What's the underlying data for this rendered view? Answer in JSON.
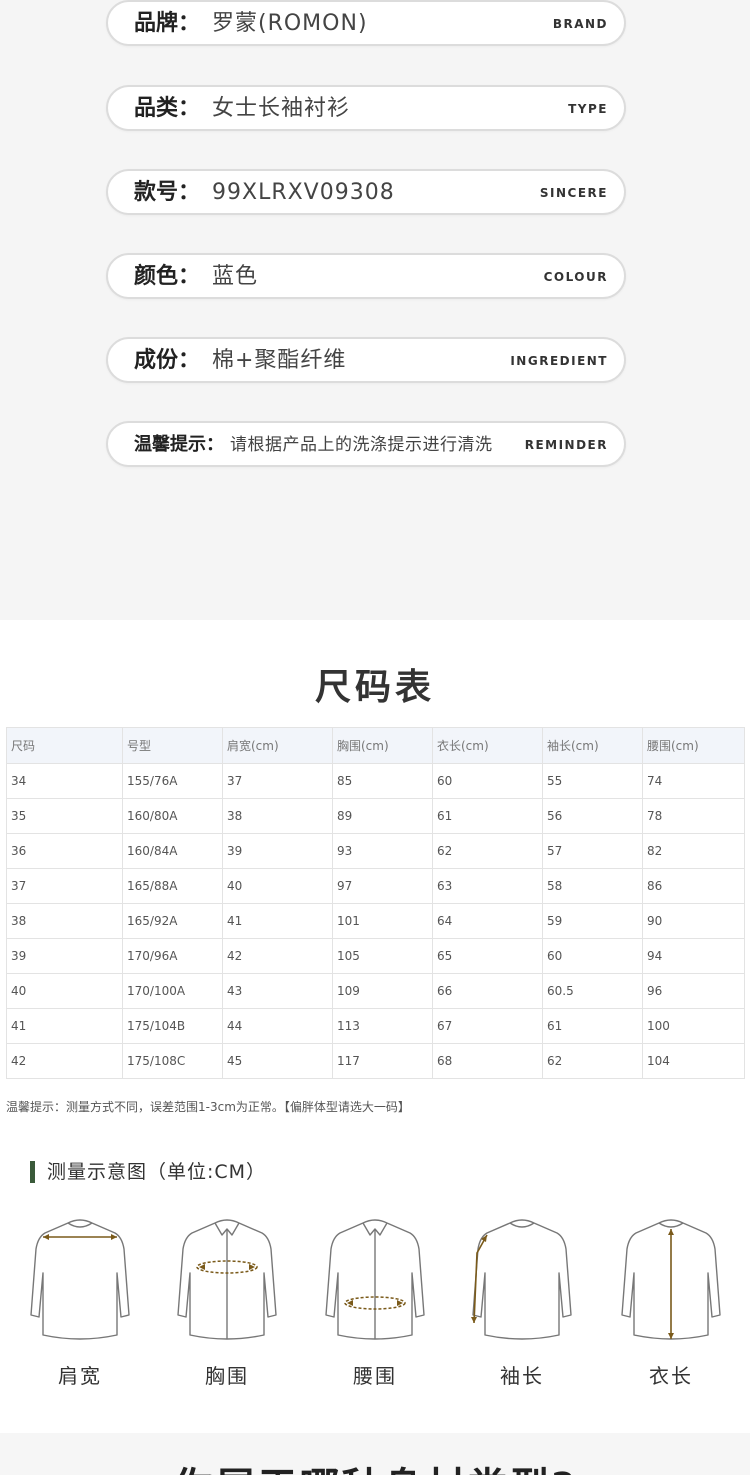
{
  "info": {
    "brand": {
      "label": "品牌：",
      "value": "罗蒙(ROMON)",
      "en": "BRAND"
    },
    "type": {
      "label": "品类：",
      "value": "女士长袖衬衫",
      "en": "TYPE"
    },
    "style": {
      "label": "款号：",
      "value": "99XLRXV09308",
      "en": "SINCERE"
    },
    "color": {
      "label": "颜色：",
      "value": "蓝色",
      "en": "COLOUR"
    },
    "ingredient": {
      "label": "成份：",
      "value": "棉+聚酯纤维",
      "en": "INGREDIENT"
    },
    "reminder": {
      "label": "温馨提示：",
      "value": "请根据产品上的洗涤提示进行清洗",
      "en": "REMINDER"
    }
  },
  "size_table": {
    "title": "尺码表",
    "headers": [
      "尺码",
      "号型",
      "肩宽(cm)",
      "胸围(cm)",
      "衣长(cm)",
      "袖长(cm)",
      "腰围(cm)"
    ],
    "rows": [
      [
        "34",
        "155/76A",
        "37",
        "85",
        "60",
        "55",
        "74"
      ],
      [
        "35",
        "160/80A",
        "38",
        "89",
        "61",
        "56",
        "78"
      ],
      [
        "36",
        "160/84A",
        "39",
        "93",
        "62",
        "57",
        "82"
      ],
      [
        "37",
        "165/88A",
        "40",
        "97",
        "63",
        "58",
        "86"
      ],
      [
        "38",
        "165/92A",
        "41",
        "101",
        "64",
        "59",
        "90"
      ],
      [
        "39",
        "170/96A",
        "42",
        "105",
        "65",
        "60",
        "94"
      ],
      [
        "40",
        "170/100A",
        "43",
        "109",
        "66",
        "60.5",
        "96"
      ],
      [
        "41",
        "175/104B",
        "44",
        "113",
        "67",
        "61",
        "100"
      ],
      [
        "42",
        "175/108C",
        "45",
        "117",
        "68",
        "62",
        "104"
      ]
    ],
    "note": "温馨提示：测量方式不同，误差范围1-3cm为正常。【偏胖体型请选大一码】"
  },
  "measure": {
    "heading": "测量示意图（单位:CM）",
    "items": [
      {
        "label": "肩宽",
        "icon": "shirt-shoulder-width-icon"
      },
      {
        "label": "胸围",
        "icon": "shirt-chest-icon"
      },
      {
        "label": "腰围",
        "icon": "shirt-waist-icon"
      },
      {
        "label": "袖长",
        "icon": "shirt-sleeve-length-icon"
      },
      {
        "label": "衣长",
        "icon": "shirt-body-length-icon"
      }
    ]
  },
  "bottom": {
    "title": "你属于哪种身材类型?"
  },
  "colors": {
    "accent": "#3a5a3a",
    "arrow": "#7a5a1a",
    "outline": "#777777"
  }
}
